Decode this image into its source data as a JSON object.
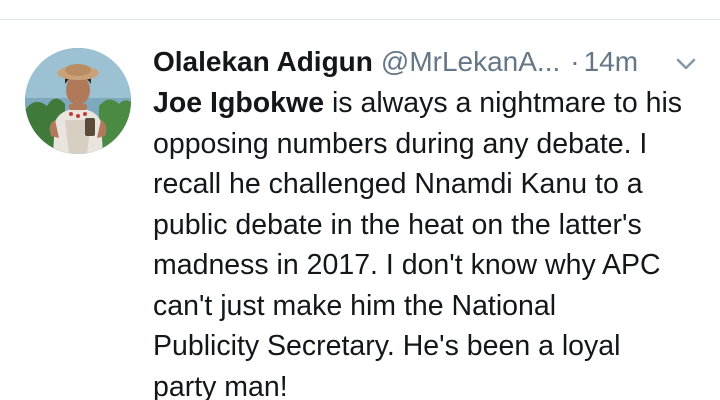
{
  "tweet": {
    "display_name": "Olalekan Adigun",
    "handle": "@MrLekanA...",
    "separator": "·",
    "timestamp": "14m",
    "body": {
      "lines": [
        {
          "bold": "Joe Igbokwe",
          "rest": " is always a nightmare to his"
        },
        {
          "text": "opposing numbers during any debate. I"
        },
        {
          "text": "recall he challenged Nnamdi Kanu to a"
        },
        {
          "text": "public debate in the heat on the latter's"
        },
        {
          "text": "madness in 2017. I don't know why APC"
        },
        {
          "text": "can't just make him the National"
        },
        {
          "text": "Publicity Secretary. He's been a loyal"
        },
        {
          "text": "party man!"
        }
      ]
    },
    "icons": {
      "avatar": "profile-photo",
      "caret": "chevron-down-icon"
    }
  },
  "colors": {
    "text_primary": "#14171a",
    "text_secondary": "#657786",
    "divider": "#e1e8ed",
    "background": "#ffffff"
  }
}
